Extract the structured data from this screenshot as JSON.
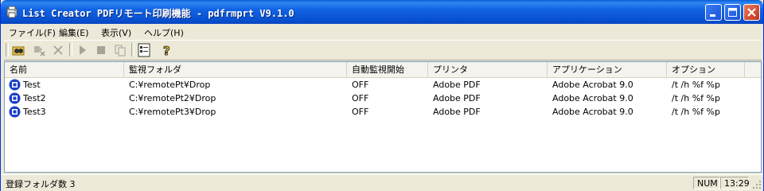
{
  "window": {
    "title": "List Creator PDFリモート印刷機能 - pdfrmprt V9.1.0"
  },
  "menu": {
    "items": [
      "ファイル(F)",
      "編集(E)",
      "表示(V)",
      "ヘルプ(H)"
    ]
  },
  "toolbar": {
    "buttons": [
      "find-folder",
      "remove",
      "delete",
      "start",
      "stop",
      "copy",
      "properties",
      "help"
    ]
  },
  "list": {
    "columns": [
      "名前",
      "監視フォルダ",
      "自動監視開始",
      "プリンタ",
      "アプリケーション",
      "オプション"
    ],
    "rows": [
      {
        "name": "Test",
        "folder": "C:¥remotePt¥Drop",
        "auto": "OFF",
        "printer": "Adobe PDF",
        "app": "Adobe Acrobat 9.0",
        "option": "/t /h %f %p"
      },
      {
        "name": "Test2",
        "folder": "C:¥remotePt2¥Drop",
        "auto": "OFF",
        "printer": "Adobe PDF",
        "app": "Adobe Acrobat 9.0",
        "option": "/t /h %f %p"
      },
      {
        "name": "Test3",
        "folder": "C:¥remotePt3¥Drop",
        "auto": "OFF",
        "printer": "Adobe PDF",
        "app": "Adobe Acrobat 9.0",
        "option": "/t /h %f %p"
      }
    ]
  },
  "status": {
    "text": "登録フォルダ数 3",
    "num": "NUM",
    "time": "13:29"
  },
  "colors": {
    "titlebar": "#0a55d5",
    "selected_row_icon": "#1a3fc9"
  }
}
